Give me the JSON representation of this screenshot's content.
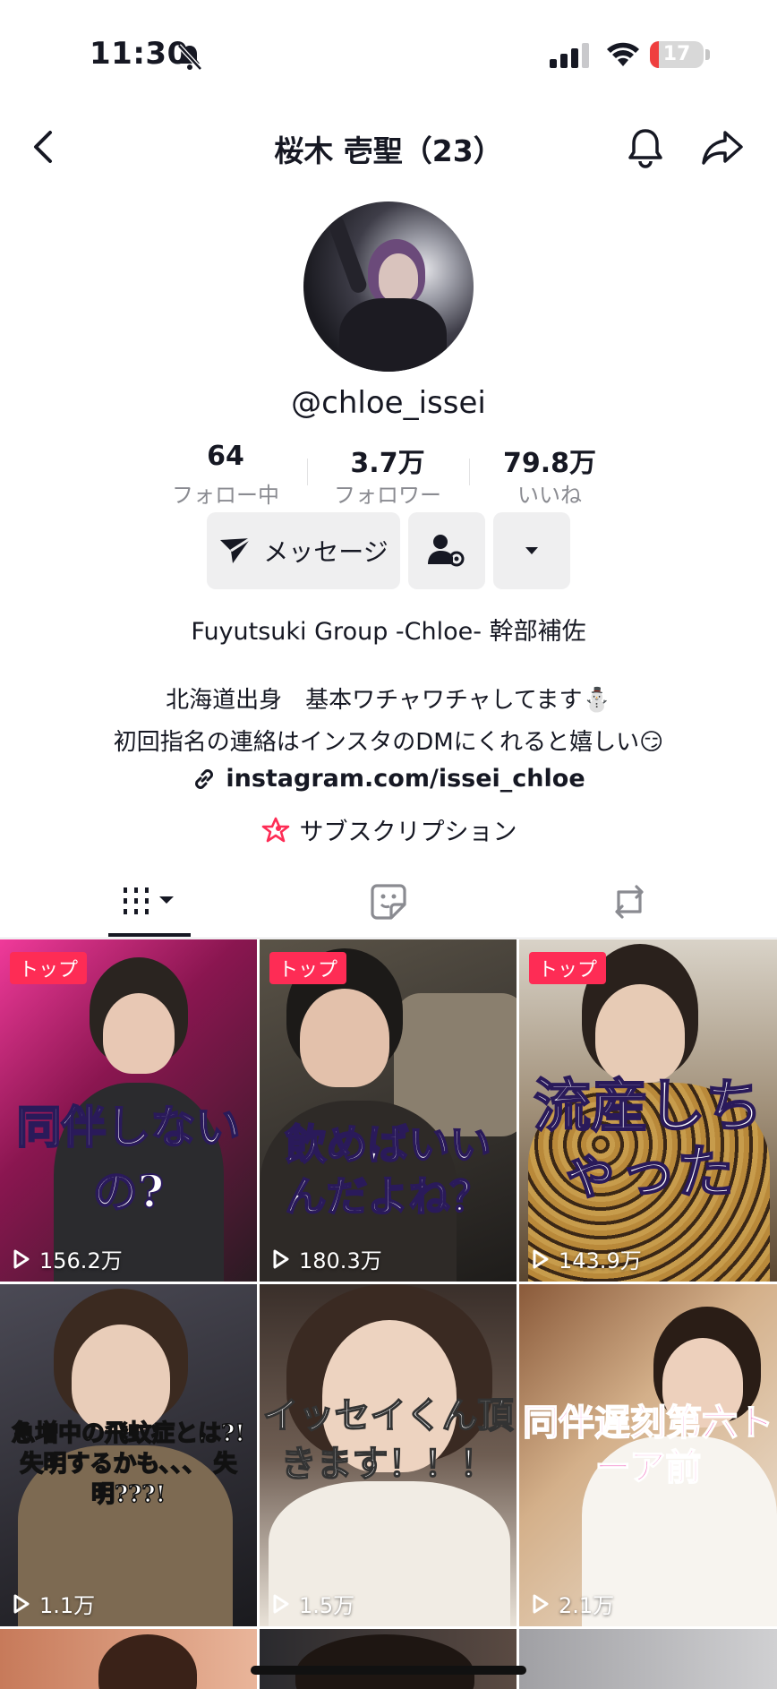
{
  "status_bar": {
    "time": "11:30",
    "battery": "17",
    "battery_level": 0.17
  },
  "header": {
    "title": "桜木 壱聖（23）"
  },
  "profile": {
    "handle": "@chloe_issei",
    "stats": [
      {
        "value": "64",
        "label": "フォロー中"
      },
      {
        "value": "3.7万",
        "label": "フォロワー"
      },
      {
        "value": "79.8万",
        "label": "いいね"
      }
    ],
    "message_button": "メッセージ",
    "group": "Fuyutsuki Group -Chloe- 幹部補佐",
    "bio_line1": "北海道出身　基本ワチャワチャしてます⛄",
    "bio_line2": "初回指名の連絡はインスタのDMにくれると嬉しい😏",
    "link": "instagram.com/issei_chloe",
    "subscription": "サブスクリプション"
  },
  "icons": {
    "back": "chevron-left-icon",
    "bell": "bell-icon",
    "share": "share-arrow-icon",
    "grid_tab": "grid-icon",
    "liked_tab": "sticker-icon",
    "repost_tab": "repost-icon"
  },
  "videos": [
    {
      "badge": "トップ",
      "views": "156.2万",
      "caption": "同伴しないの?",
      "color": "#c21a6b"
    },
    {
      "badge": "トップ",
      "views": "180.3万",
      "caption": "飲めばいいんだよね？",
      "color": "#3a3631"
    },
    {
      "badge": "トップ",
      "views": "143.9万",
      "caption": "流産しちゃった",
      "color": "#7a5a2a"
    },
    {
      "badge": "",
      "views": "1.1万",
      "caption": "急増中の飛蚊症とは?! 失明するかも、、、 失明???!",
      "color": "#3d3c40"
    },
    {
      "badge": "",
      "views": "1.5万",
      "caption": "イッセイくん頂きます！！！",
      "color": "#6a5a50"
    },
    {
      "badge": "",
      "views": "2.1万",
      "caption": "同伴遅刻第六トーア前",
      "color": "#c7a888"
    }
  ]
}
